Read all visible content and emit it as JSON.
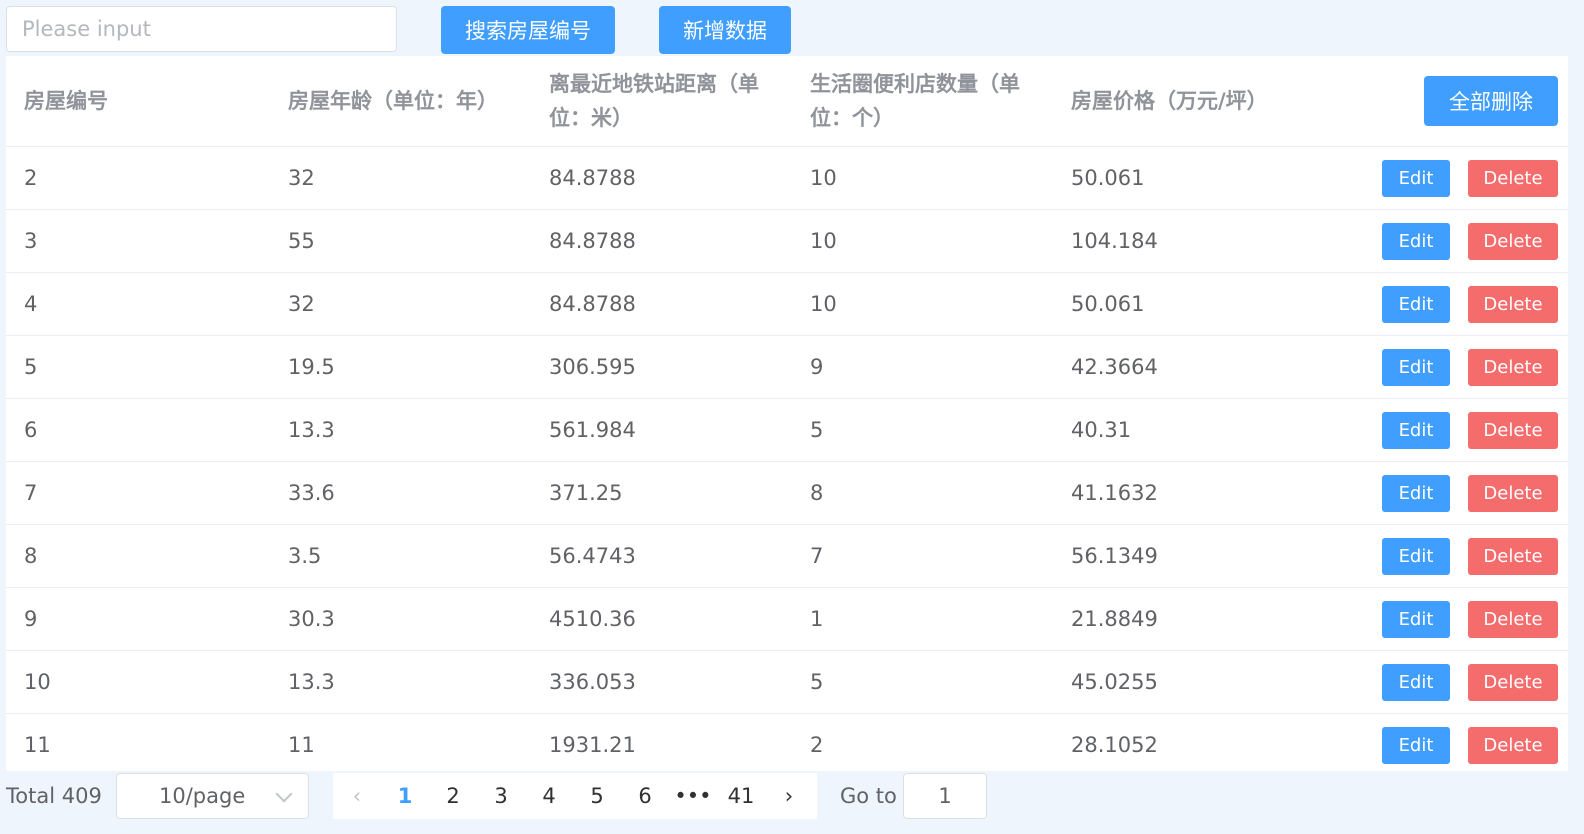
{
  "search": {
    "placeholder": "Please input",
    "value": ""
  },
  "toolbar": {
    "search_label": "搜索房屋编号",
    "add_label": "新增数据"
  },
  "table": {
    "headers": [
      "房屋编号",
      "房屋年龄（单位：年）",
      "离最近地铁站距离（单位：米）",
      "生活圈便利店数量（单位：个）",
      "房屋价格（万元/坪）"
    ],
    "delete_all_label": "全部删除",
    "edit_label": "Edit",
    "delete_label": "Delete",
    "rows": [
      [
        "2",
        "32",
        "84.8788",
        "10",
        "50.061"
      ],
      [
        "3",
        "55",
        "84.8788",
        "10",
        "104.184"
      ],
      [
        "4",
        "32",
        "84.8788",
        "10",
        "50.061"
      ],
      [
        "5",
        "19.5",
        "306.595",
        "9",
        "42.3664"
      ],
      [
        "6",
        "13.3",
        "561.984",
        "5",
        "40.31"
      ],
      [
        "7",
        "33.6",
        "371.25",
        "8",
        "41.1632"
      ],
      [
        "8",
        "3.5",
        "56.4743",
        "7",
        "56.1349"
      ],
      [
        "9",
        "30.3",
        "4510.36",
        "1",
        "21.8849"
      ],
      [
        "10",
        "13.3",
        "336.053",
        "5",
        "45.0255"
      ],
      [
        "11",
        "11",
        "1931.21",
        "2",
        "28.1052"
      ]
    ]
  },
  "pagination": {
    "total": "Total 409",
    "page_size": "10/page",
    "pages": [
      "1",
      "2",
      "3",
      "4",
      "5",
      "6",
      "•••",
      "41"
    ],
    "current": "1",
    "goto_label": "Go to",
    "goto_value": "1"
  },
  "colors": {
    "primary": "#409eff",
    "danger": "#f56c6c",
    "background": "#eef5fd"
  }
}
